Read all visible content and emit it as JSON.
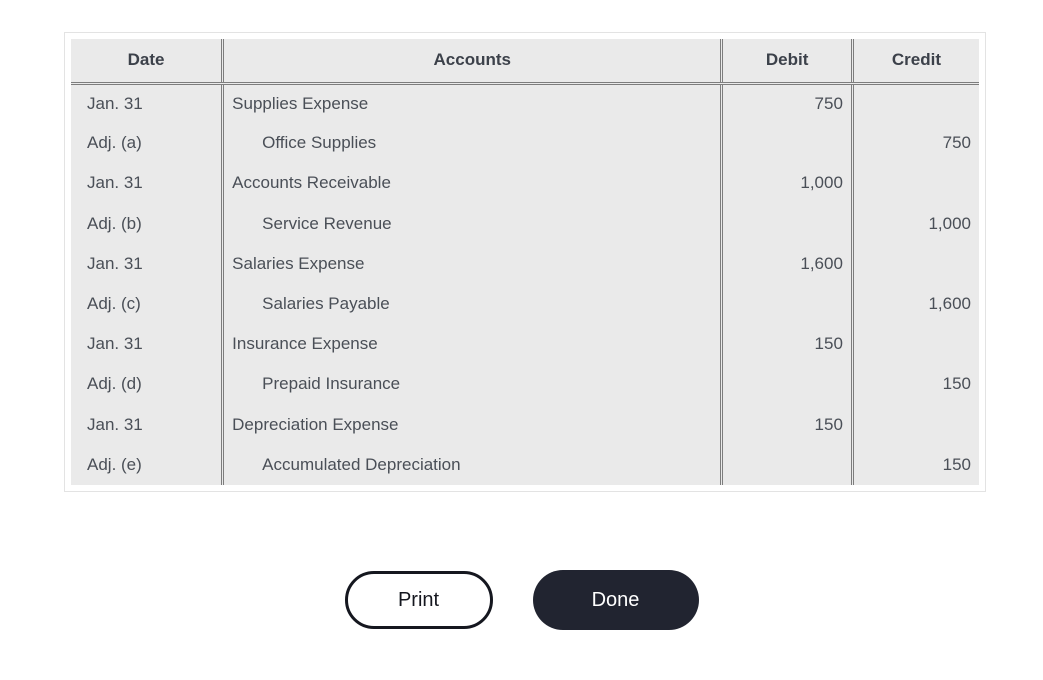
{
  "table": {
    "headers": [
      "Date",
      "Accounts",
      "Debit",
      "Credit"
    ],
    "rows": [
      {
        "date": "Jan. 31",
        "account": "Supplies Expense",
        "indented": false,
        "debit": "750",
        "credit": ""
      },
      {
        "date": "Adj. (a)",
        "account": "Office Supplies",
        "indented": true,
        "debit": "",
        "credit": "750"
      },
      {
        "date": "Jan. 31",
        "account": "Accounts Receivable",
        "indented": false,
        "debit": "1,000",
        "credit": ""
      },
      {
        "date": "Adj. (b)",
        "account": "Service Revenue",
        "indented": true,
        "debit": "",
        "credit": "1,000"
      },
      {
        "date": "Jan. 31",
        "account": "Salaries Expense",
        "indented": false,
        "debit": "1,600",
        "credit": ""
      },
      {
        "date": "Adj. (c)",
        "account": "Salaries Payable",
        "indented": true,
        "debit": "",
        "credit": "1,600"
      },
      {
        "date": "Jan. 31",
        "account": "Insurance Expense",
        "indented": false,
        "debit": "150",
        "credit": ""
      },
      {
        "date": "Adj. (d)",
        "account": "Prepaid Insurance",
        "indented": true,
        "debit": "",
        "credit": "150"
      },
      {
        "date": "Jan. 31",
        "account": "Depreciation Expense",
        "indented": false,
        "debit": "150",
        "credit": ""
      },
      {
        "date": "Adj. (e)",
        "account": "Accumulated Depreciation",
        "indented": true,
        "debit": "",
        "credit": "150"
      }
    ]
  },
  "buttons": {
    "print_label": "Print",
    "done_label": "Done"
  },
  "colors": {
    "cell_background": "#eaeaea",
    "text": "#4a4f57",
    "header_text": "#3c414a",
    "rule": "#7d7d7d",
    "done_button_background": "#212430",
    "print_button_border": "#15171f"
  }
}
